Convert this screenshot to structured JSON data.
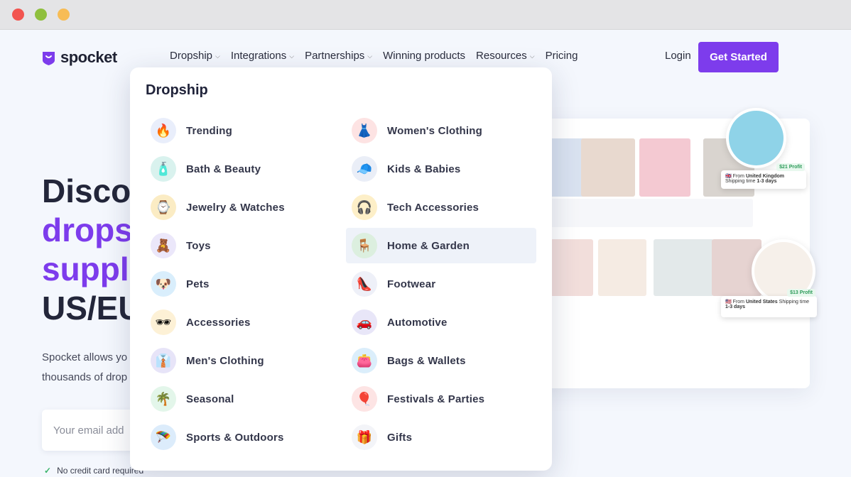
{
  "window": {
    "controls": [
      "close",
      "minimize",
      "maximize"
    ]
  },
  "header": {
    "logo_text": "spocket",
    "nav": [
      {
        "label": "Dropship",
        "dropdown": true
      },
      {
        "label": "Integrations",
        "dropdown": true
      },
      {
        "label": "Partnerships",
        "dropdown": true
      },
      {
        "label": "Winning products",
        "dropdown": false
      },
      {
        "label": "Resources",
        "dropdown": true
      },
      {
        "label": "Pricing",
        "dropdown": false
      }
    ],
    "login": "Login",
    "cta": "Get Started",
    "accent_color": "#7d3cec"
  },
  "hero": {
    "title_line1": "Disco",
    "title_line2": "drops",
    "title_line3": "suppl",
    "title_line4": "US/EU",
    "description_line1": "Spocket allows yo",
    "description_line2": "thousands of drop",
    "email_placeholder": "Your email add",
    "no_credit_card": "No credit card required"
  },
  "mockup": {
    "tag_uk": {
      "profit": "$21 Profit",
      "from_label": "From",
      "from": "United Kingdom",
      "ship_label": "Shipping time",
      "ship": "1-3 days"
    },
    "tag_us": {
      "profit": "$13 Profit",
      "from_label": "From",
      "from": "United States",
      "ship_label": "Shipping time",
      "ship": "1-3 days"
    }
  },
  "dropdown": {
    "title": "Dropship",
    "left": [
      {
        "label": "Trending",
        "icon": "fire-icon",
        "glyph": "🔥",
        "bg": "#e9eefb"
      },
      {
        "label": "Bath & Beauty",
        "icon": "perfume-icon",
        "glyph": "🧴",
        "bg": "#d9f2ee"
      },
      {
        "label": "Jewelry & Watches",
        "icon": "watch-icon",
        "glyph": "⌚",
        "bg": "#fbecc4"
      },
      {
        "label": "Toys",
        "icon": "teddy-bear-icon",
        "glyph": "🧸",
        "bg": "#ebe7fa"
      },
      {
        "label": "Pets",
        "icon": "dog-icon",
        "glyph": "🐶",
        "bg": "#d9eefc"
      },
      {
        "label": "Accessories",
        "icon": "sunglasses-icon",
        "glyph": "🕶",
        "bg": "#fdf1d6"
      },
      {
        "label": "Men's Clothing",
        "icon": "suit-icon",
        "glyph": "👔",
        "bg": "#e7e4f8"
      },
      {
        "label": "Seasonal",
        "icon": "palm-tree-icon",
        "glyph": "🌴",
        "bg": "#e3f6ea"
      },
      {
        "label": "Sports & Outdoors",
        "icon": "parachute-icon",
        "glyph": "🪂",
        "bg": "#dcecfb"
      }
    ],
    "right": [
      {
        "label": "Women's Clothing",
        "icon": "dress-icon",
        "glyph": "👗",
        "bg": "#fde3e3"
      },
      {
        "label": "Kids & Babies",
        "icon": "cap-icon",
        "glyph": "🧢",
        "bg": "#eaeef7"
      },
      {
        "label": "Tech Accessories",
        "icon": "headphones-icon",
        "glyph": "🎧",
        "bg": "#fdefc8"
      },
      {
        "label": "Home & Garden",
        "icon": "chair-icon",
        "glyph": "🪑",
        "bg": "#dcefdf",
        "active": true
      },
      {
        "label": "Footwear",
        "icon": "high-heel-icon",
        "glyph": "👠",
        "bg": "#eef0f8"
      },
      {
        "label": "Automotive",
        "icon": "car-icon",
        "glyph": "🚗",
        "bg": "#e8e6f8"
      },
      {
        "label": "Bags & Wallets",
        "icon": "bag-icon",
        "glyph": "👛",
        "bg": "#dbeefb"
      },
      {
        "label": "Festivals & Parties",
        "icon": "balloons-icon",
        "glyph": "🎈",
        "bg": "#fde4e4"
      },
      {
        "label": "Gifts",
        "icon": "gift-icon",
        "glyph": "🎁",
        "bg": "#f3f4f8"
      }
    ]
  }
}
